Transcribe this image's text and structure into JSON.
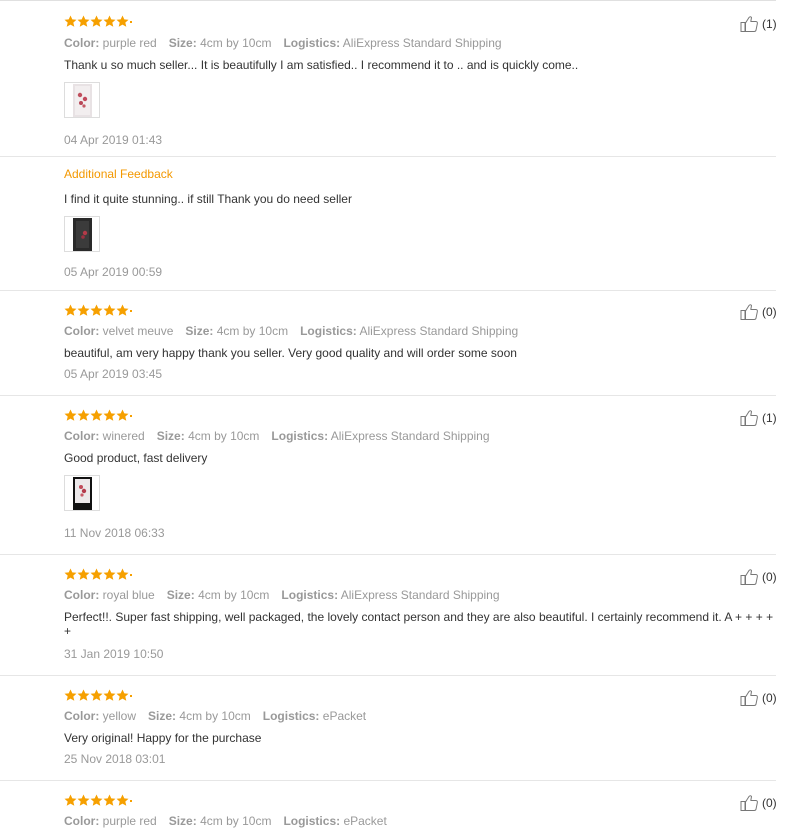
{
  "colors": {
    "star": "#f6a000",
    "accent": "#f39800",
    "muted": "#999999",
    "text": "#333333"
  },
  "labels": {
    "color": "Color:",
    "size": "Size:",
    "logistics": "Logistics:"
  },
  "reviews": [
    {
      "rating": 5,
      "helpful": "(1)",
      "color": "purple red",
      "size": "4cm by 10cm",
      "logistics": "AliExpress Standard Shipping",
      "text": "Thank u so much seller... It is beautifully I am satisfied.. I recommend it to .. and is quickly come..",
      "date": "04 Apr 2019 01:43",
      "additional": {
        "heading": "Additional Feedback",
        "text": "I find it quite stunning.. if still Thank you do need seller",
        "date": "05 Apr 2019 00:59"
      }
    },
    {
      "rating": 5,
      "helpful": "(0)",
      "color": "velvet meuve",
      "size": "4cm by 10cm",
      "logistics": "AliExpress Standard Shipping",
      "text": "beautiful, am very happy thank you seller. Very good quality and will order some soon",
      "date": "05 Apr 2019 03:45"
    },
    {
      "rating": 5,
      "helpful": "(1)",
      "color": "winered",
      "size": "4cm by 10cm",
      "logistics": "AliExpress Standard Shipping",
      "text": "Good product, fast delivery",
      "date": "11 Nov 2018 06:33"
    },
    {
      "rating": 5,
      "helpful": "(0)",
      "color": "royal blue",
      "size": "4cm by 10cm",
      "logistics": "AliExpress Standard Shipping",
      "text": "Perfect!!. Super fast shipping, well packaged, the lovely contact person and they are also beautiful. I certainly recommend it. A + + + + +",
      "date": "31 Jan 2019 10:50"
    },
    {
      "rating": 5,
      "helpful": "(0)",
      "color": "yellow",
      "size": "4cm by 10cm",
      "logistics": "ePacket",
      "text": "Very original! Happy for the purchase",
      "date": "25 Nov 2018 03:01"
    },
    {
      "rating": 5,
      "helpful": "(0)",
      "color": "purple red",
      "size": "4cm by 10cm",
      "logistics": "ePacket"
    }
  ]
}
